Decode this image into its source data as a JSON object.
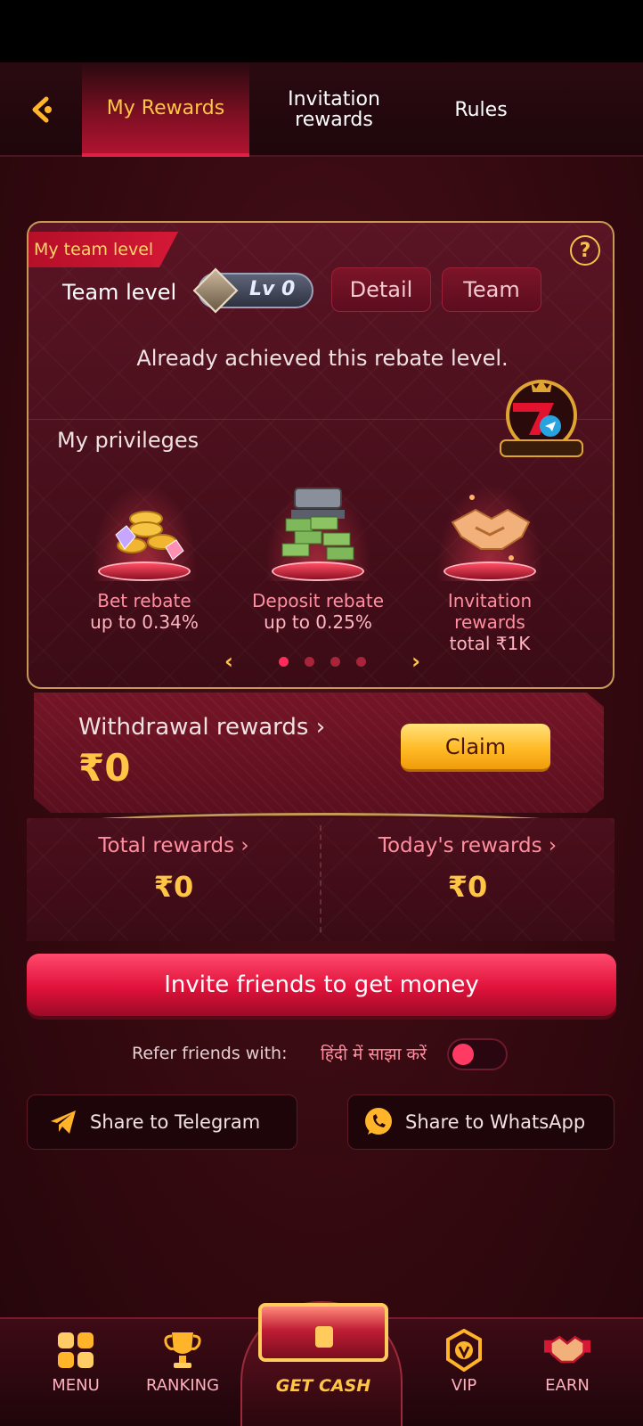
{
  "header": {
    "tabs": [
      {
        "label": "My Rewards",
        "active": true
      },
      {
        "label": "Invitation rewards",
        "active": false
      },
      {
        "label": "Rules",
        "active": false
      }
    ]
  },
  "team_card": {
    "ribbon": "My team level",
    "team_level_label": "Team level",
    "level_badge": "Lv 0",
    "detail_label": "Detail",
    "team_label": "Team",
    "achieved_text": "Already achieved this rebate level.",
    "privileges_title": "My privileges",
    "privileges": [
      {
        "name": "Bet rebate",
        "value": "up to 0.34%"
      },
      {
        "name": "Deposit rebate",
        "value": "up to 0.25%"
      },
      {
        "name": "Invitation rewards",
        "value": "total ₹1K"
      }
    ],
    "pager": {
      "prev": "‹",
      "next": "›",
      "page": 1,
      "pages": 4
    }
  },
  "withdraw": {
    "title": "Withdrawal rewards ›",
    "amount": "₹0",
    "claim_label": "Claim"
  },
  "totals": {
    "total_label": "Total rewards ›",
    "total_value": "₹0",
    "today_label": "Today's rewards ›",
    "today_value": "₹0"
  },
  "invite_label": "Invite friends to get money",
  "refer": {
    "label": "Refer friends with:",
    "hindi": "हिंदी में साझा करें",
    "toggle_on": false
  },
  "share": {
    "telegram": "Share to Telegram",
    "whatsapp": "Share to WhatsApp"
  },
  "nav": {
    "menu": "MENU",
    "ranking": "RANKING",
    "get_cash": "GET CASH",
    "vip": "VIP",
    "earn": "EARN"
  },
  "colors": {
    "accent_gold": "#ffc545",
    "accent_red": "#e0113a",
    "label_pink": "#ff8fa0"
  }
}
